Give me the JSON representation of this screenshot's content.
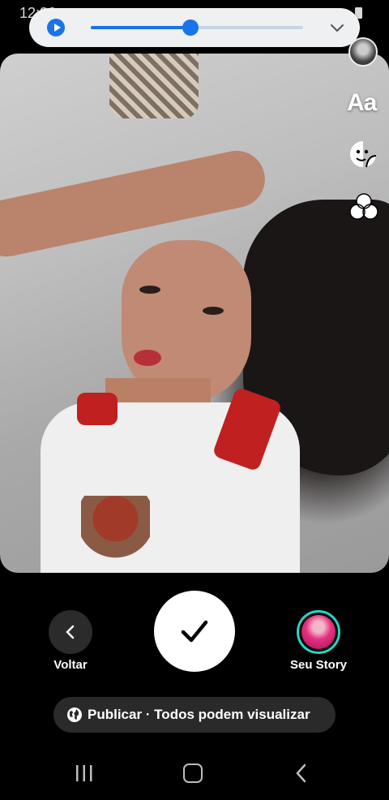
{
  "status_bar": {
    "time": "12:36"
  },
  "audio_player": {
    "progress": 0.47,
    "state": "paused"
  },
  "tools": [
    {
      "id": "text",
      "label": "Aa"
    },
    {
      "id": "sticker",
      "icon": "sticker-icon"
    },
    {
      "id": "effects",
      "icon": "effects-icon"
    }
  ],
  "controls": {
    "back_label": "Voltar",
    "story_label": "Seu Story"
  },
  "publish": {
    "text": "Publicar · Todos podem visualizar"
  },
  "colors": {
    "accent_blue": "#1a73e8",
    "story_ring": "#2ad4c8"
  }
}
